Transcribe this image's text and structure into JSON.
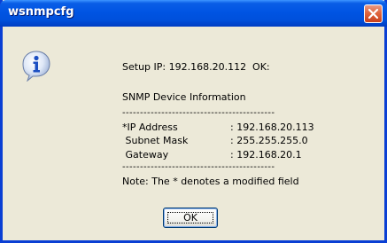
{
  "window": {
    "title": "wsnmpcfg"
  },
  "icons": {
    "info": "information-balloon-icon",
    "close": "close-icon"
  },
  "colors": {
    "titlebar": "#0054e3",
    "close_button": "#e0663e",
    "dialog_background": "#ece9d8"
  },
  "message": {
    "setup_line": "Setup IP: 192.168.20.112  OK:",
    "section_title": "SNMP Device Information",
    "separator": "-------------------------------------------",
    "rows": [
      {
        "label": "*IP Address",
        "value": ": 192.168.20.113"
      },
      {
        "label": " Subnet Mask",
        "value": ": 255.255.255.0"
      },
      {
        "label": " Gateway",
        "value": ": 192.168.20.1"
      }
    ],
    "note": "Note: The * denotes a modified field"
  },
  "buttons": {
    "ok_label": "OK"
  }
}
